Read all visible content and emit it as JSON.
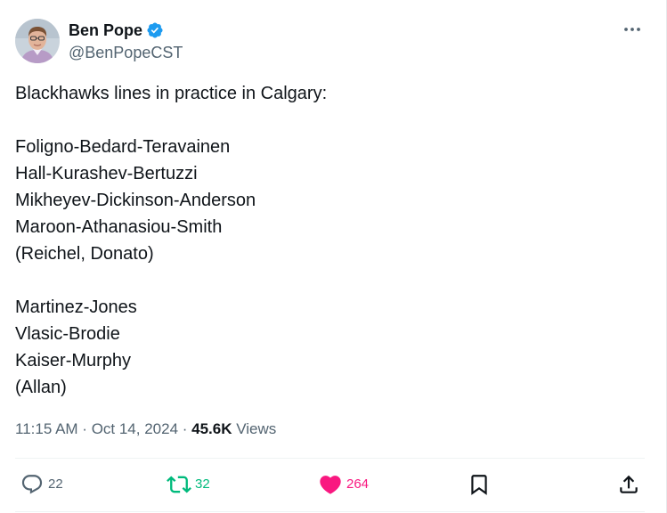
{
  "author": {
    "name": "Ben Pope",
    "handle": "@BenPopeCST",
    "verified": true,
    "avatar": "user-avatar-photo"
  },
  "tweet": {
    "lines": [
      "Blackhawks lines in practice in Calgary:",
      "",
      "Foligno-Bedard-Teravainen",
      "Hall-Kurashev-Bertuzzi",
      "Mikheyev-Dickinson-Anderson",
      "Maroon-Athanasiou-Smith",
      "(Reichel, Donato)",
      "",
      "Martinez-Jones",
      "Vlasic-Brodie",
      "Kaiser-Murphy",
      "(Allan)"
    ]
  },
  "meta": {
    "time": "11:15 AM",
    "separator": " · ",
    "date": "Oct 14, 2024",
    "views_count": "45.6K",
    "views_label": " Views"
  },
  "actions": {
    "replies": "22",
    "reposts": "32",
    "likes": "264"
  },
  "icons": {
    "more": "more-horizontal-icon",
    "verified": "verified-badge-icon",
    "reply": "reply-icon",
    "repost": "repost-icon",
    "like": "heart-icon",
    "bookmark": "bookmark-icon",
    "share": "share-icon"
  },
  "colors": {
    "verified": "#1d9bf0",
    "secondary_text": "#536471",
    "repost": "#00ba7c",
    "like": "#f91880",
    "divider": "#eff3f4"
  }
}
